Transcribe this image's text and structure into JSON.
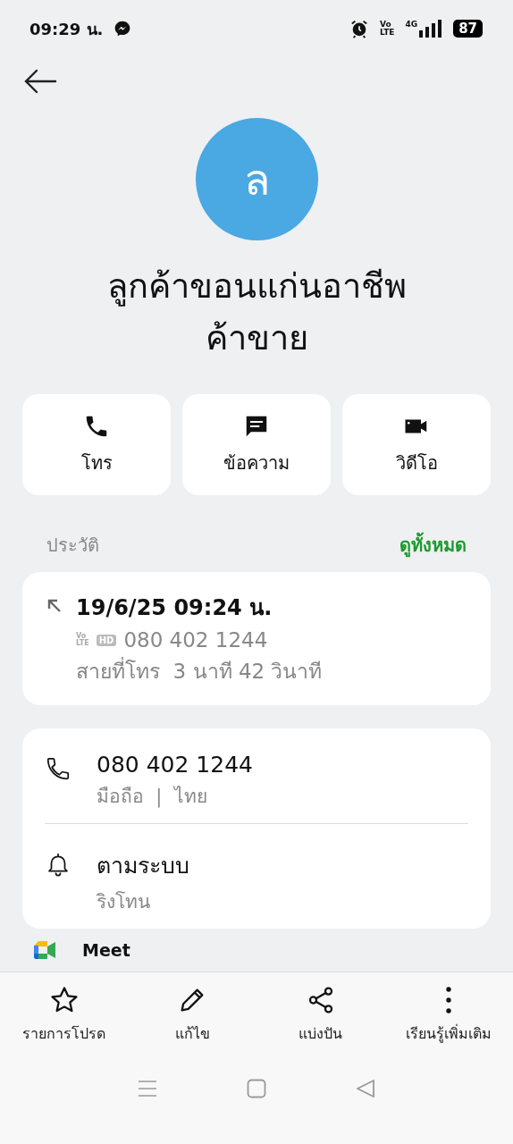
{
  "status_bar": {
    "time": "09:29 น.",
    "volte": [
      "Vo",
      "LTE"
    ],
    "network": "4G",
    "battery": "87"
  },
  "contact": {
    "initial": "ล",
    "name": "ลูกค้าขอนแก่นอาชีพค้าขาย"
  },
  "actions": [
    {
      "kind": "call",
      "label": "โทร"
    },
    {
      "kind": "message",
      "label": "ข้อความ"
    },
    {
      "kind": "video",
      "label": "วิดีโอ"
    }
  ],
  "history": {
    "title": "ประวัติ",
    "link": "ดูทั้งหมด",
    "entry": {
      "datetime": "19/6/25 09:24 น.",
      "volte": [
        "Vo",
        "LTE"
      ],
      "hd": "HD",
      "number": "080 402 1244",
      "duration": "สายที่โทร  3 นาที 42 วินาที"
    }
  },
  "details": [
    {
      "kind": "phone",
      "primary": "080 402 1244",
      "secondary": "มือถือ  |  ไทย"
    },
    {
      "kind": "ringtone",
      "primary": "ตามระบบ",
      "secondary": "ริงโทน"
    }
  ],
  "apps": [
    {
      "label": "Meet"
    }
  ],
  "bottom_bar": [
    {
      "kind": "star",
      "label": "รายการโปรด"
    },
    {
      "kind": "edit",
      "label": "แก้ไข"
    },
    {
      "kind": "share",
      "label": "แบ่งปัน"
    },
    {
      "kind": "more",
      "label": "เรียนรู้เพิ่มเติม"
    }
  ]
}
